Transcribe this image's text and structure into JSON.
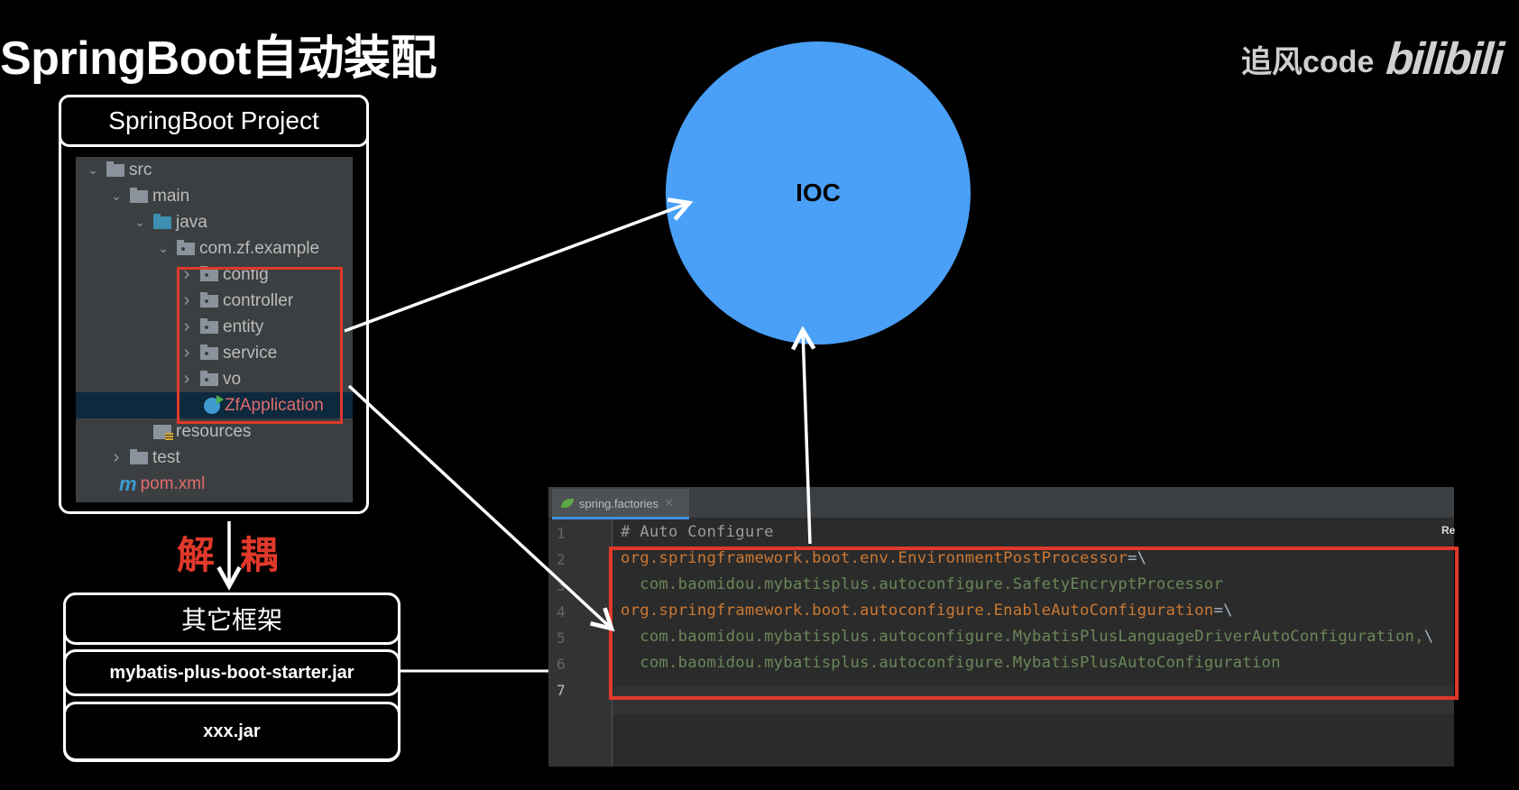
{
  "title": "SpringBoot自动装配",
  "brand": {
    "author": "追风code",
    "logo": "bilibili"
  },
  "project": {
    "header": "SpringBoot Project",
    "tree": [
      {
        "label": "src",
        "indent": 0,
        "chevron": "down",
        "icon": "folder-icon"
      },
      {
        "label": "main",
        "indent": 1,
        "chevron": "down",
        "icon": "folder-icon"
      },
      {
        "label": "java",
        "indent": 2,
        "chevron": "down",
        "icon": "source-folder-icon"
      },
      {
        "label": "com.zf.example",
        "indent": 3,
        "chevron": "down",
        "icon": "package-icon"
      },
      {
        "label": "config",
        "indent": 4,
        "chevron": "right",
        "icon": "package-icon"
      },
      {
        "label": "controller",
        "indent": 4,
        "chevron": "right",
        "icon": "package-icon"
      },
      {
        "label": "entity",
        "indent": 4,
        "chevron": "right",
        "icon": "package-icon"
      },
      {
        "label": "service",
        "indent": 4,
        "chevron": "right",
        "icon": "package-icon"
      },
      {
        "label": "vo",
        "indent": 4,
        "chevron": "right",
        "icon": "package-icon"
      },
      {
        "label": "ZfApplication",
        "indent": 4,
        "chevron": "none",
        "icon": "spring-app-class-icon",
        "selected": true
      },
      {
        "label": "resources",
        "indent": 2,
        "chevron": "none",
        "icon": "resources-folder-icon"
      },
      {
        "label": "test",
        "indent": 1,
        "chevron": "right",
        "icon": "folder-icon"
      },
      {
        "label": "pom.xml",
        "indent": 0,
        "chevron": "none",
        "icon": "maven-icon"
      }
    ]
  },
  "decouple": {
    "left": "解",
    "right": "耦"
  },
  "frameworks": {
    "header": "其它框架",
    "items": [
      "mybatis-plus-boot-starter.jar",
      "xxx.jar"
    ]
  },
  "ioc": {
    "label": "IOC",
    "color": "#4aa0f7"
  },
  "editor": {
    "tab_label": "spring.factories",
    "right_label": "Re",
    "lines": [
      {
        "n": "1",
        "parts": [
          {
            "t": "# Auto Configure",
            "c": "comment"
          }
        ]
      },
      {
        "n": "2",
        "parts": [
          {
            "t": "org.springframework.boot.env.EnvironmentPostProcessor",
            "c": "key"
          },
          {
            "t": "=\\",
            "c": "op"
          }
        ]
      },
      {
        "n": "3",
        "parts": [
          {
            "t": "  com.baomidou.mybatisplus.autoconfigure.SafetyEncryptProcessor",
            "c": "val"
          }
        ]
      },
      {
        "n": "4",
        "parts": [
          {
            "t": "org.springframework.boot.autoconfigure.EnableAutoConfiguration",
            "c": "key"
          },
          {
            "t": "=\\",
            "c": "op"
          }
        ]
      },
      {
        "n": "5",
        "parts": [
          {
            "t": "  com.baomidou.mybatisplus.autoconfigure.MybatisPlusLanguageDriverAutoConfiguration,",
            "c": "val"
          },
          {
            "t": "\\",
            "c": "op"
          }
        ]
      },
      {
        "n": "6",
        "parts": [
          {
            "t": "  com.baomidou.mybatisplus.autoconfigure.MybatisPlusAutoConfiguration",
            "c": "val"
          }
        ]
      },
      {
        "n": "7",
        "parts": []
      }
    ]
  },
  "colors": {
    "highlight": "#e0392b",
    "accent": "#4aa0f7"
  }
}
